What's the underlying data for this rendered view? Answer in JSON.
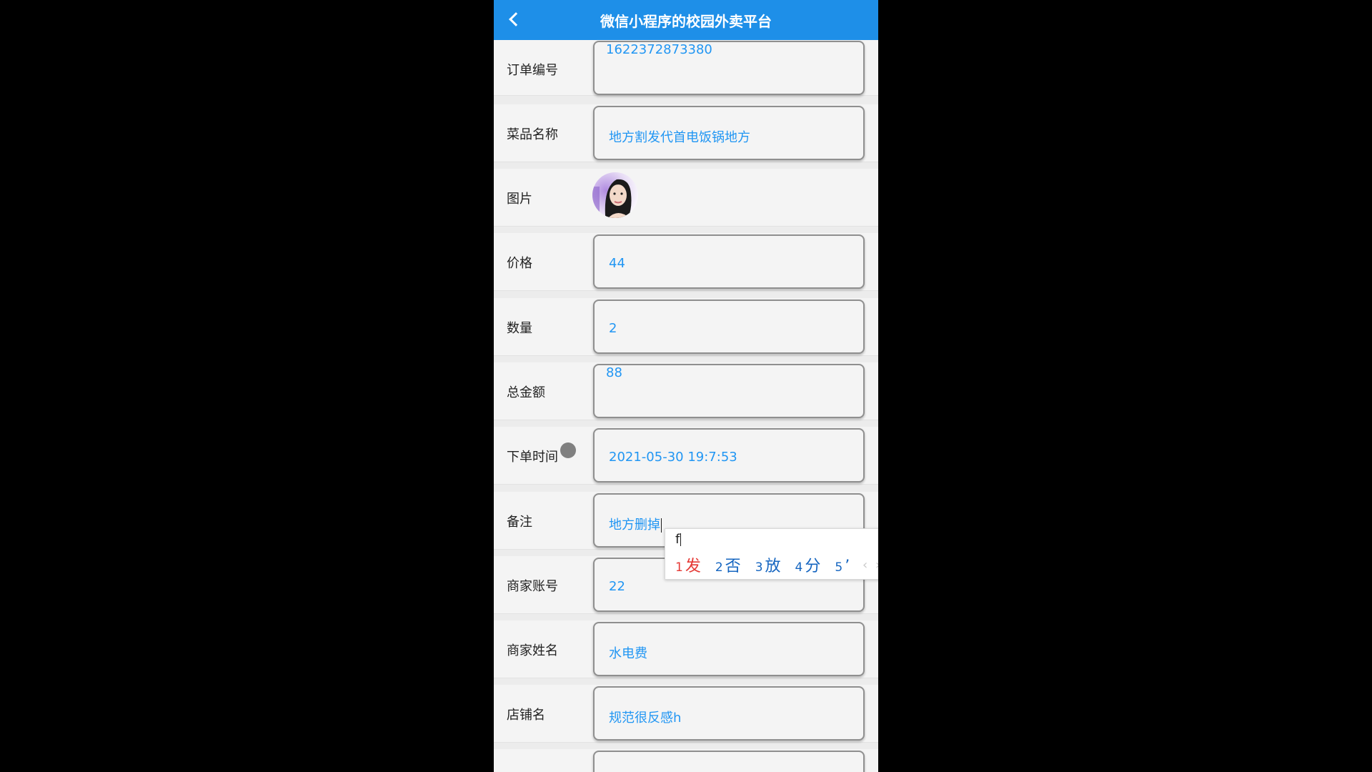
{
  "header": {
    "title": "微信小程序的校园外卖平台"
  },
  "fields": {
    "order_no": {
      "label": "订单编号",
      "value": "1622372873380"
    },
    "dish_name": {
      "label": "菜品名称",
      "value": "地方割发代首电饭锅地方"
    },
    "image": {
      "label": "图片"
    },
    "price": {
      "label": "价格",
      "value": "44"
    },
    "quantity": {
      "label": "数量",
      "value": "2"
    },
    "total": {
      "label": "总金额",
      "value": "88"
    },
    "order_time": {
      "label": "下单时间",
      "value": "2021-05-30 19:7:53"
    },
    "remark": {
      "label": "备注",
      "value": "地方删掉"
    },
    "merchant_account": {
      "label": "商家账号",
      "value": "22"
    },
    "merchant_name": {
      "label": "商家姓名",
      "value": "水电费"
    },
    "shop_name": {
      "label": "店铺名",
      "value": "规范很反感h"
    }
  },
  "ime": {
    "input": "f",
    "candidates": [
      {
        "num": "1",
        "text": "发"
      },
      {
        "num": "2",
        "text": "否"
      },
      {
        "num": "3",
        "text": "放"
      },
      {
        "num": "4",
        "text": "分"
      },
      {
        "num": "5",
        "text": "’"
      }
    ],
    "prev": "‹",
    "next": "›"
  },
  "colors": {
    "header_bg": "#1e8fe8",
    "value_text": "#2196f3",
    "ime_selected": "#e53935"
  }
}
